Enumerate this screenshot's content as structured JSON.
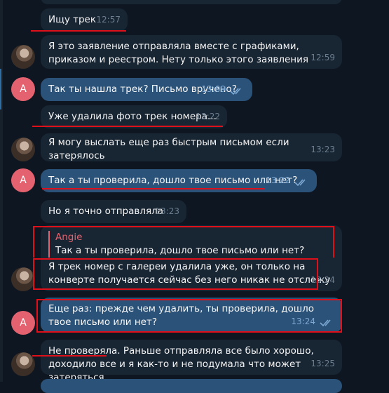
{
  "messages": [
    {
      "text": "Ищу трек",
      "time": "12:57"
    },
    {
      "text": "Я это заявление отправляла вместе с графиками, приказом и реестром. Нету только этого заявления",
      "time": "12:59"
    },
    {
      "text": "Так ты нашла трек? Письмо вручено?",
      "time": "13:09"
    },
    {
      "text": "Уже удалила фото трек номера...",
      "time": "13:22"
    },
    {
      "text": "Я могу выслать еще раз быстрым письмом если затерялось",
      "time": "13:23"
    },
    {
      "text": "Так а ты проверила, дошло твое письмо или нет?",
      "time": "13:22"
    },
    {
      "text": "Но я точно отправляла",
      "time": "13:23"
    },
    {
      "reply_author": "Angie",
      "reply_text": "Так а ты проверила, дошло твое письмо или нет?",
      "text": "Я трек номер с галереи удалила уже, он только на конверте получается сейчас без него никак не отслежу",
      "time": "13:24"
    },
    {
      "text": "Еще раз: прежде чем удалить, ты проверила, дошло твое письмо или нет?",
      "time": "13:24"
    },
    {
      "text": "Не проверяла. Раньше отправляла все было хорошо, доходило все и я как-то и не подумала что может затеряться",
      "time": "13:25"
    }
  ],
  "avatar_letter": "A",
  "colors": {
    "incoming": "#182533",
    "outgoing": "#2b5278",
    "background": "#0e1621",
    "avatar": "#e4626f",
    "highlight": "#e0101a"
  }
}
